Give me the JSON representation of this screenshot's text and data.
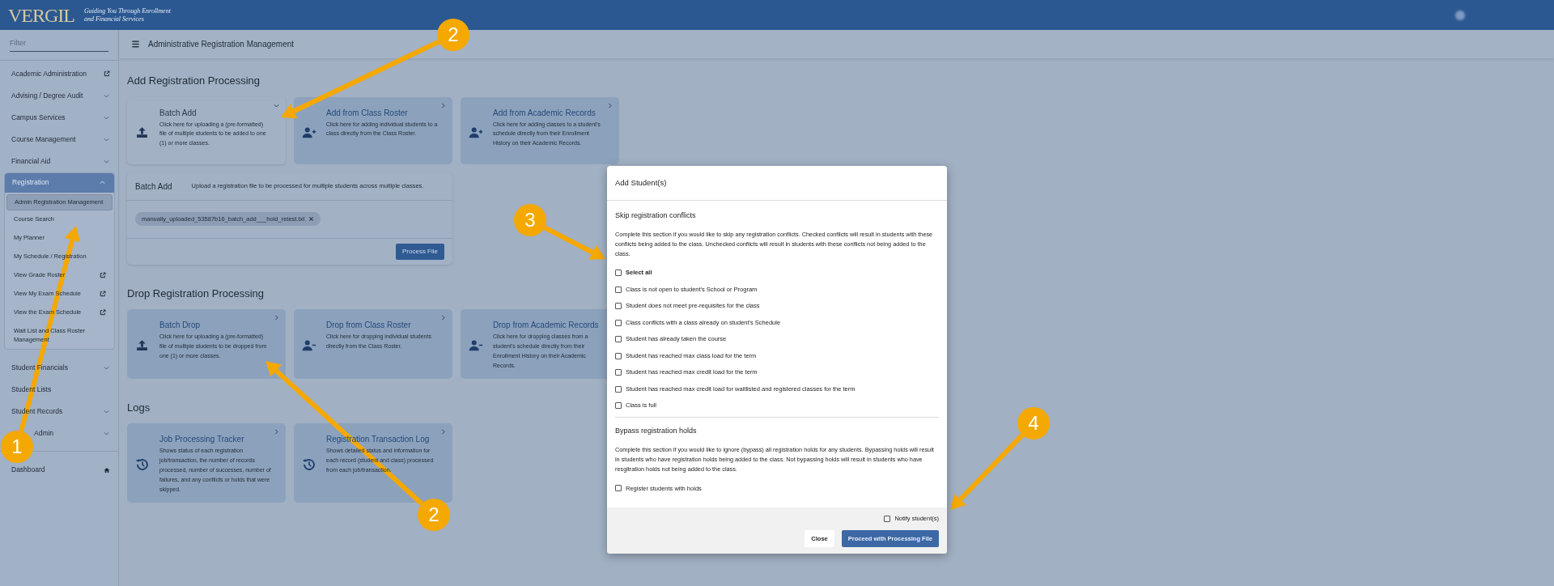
{
  "header": {
    "logo": "VERGIL",
    "tagline": [
      "Guiding You Through Enrollment",
      "and Financial Services"
    ]
  },
  "sidebar": {
    "filter_placeholder": "Filter",
    "items": [
      {
        "label": "Academic Administration",
        "kind": "external"
      },
      {
        "label": "Advising / Degree Audit",
        "kind": "expandable",
        "expanded": false
      },
      {
        "label": "Campus Services",
        "kind": "expandable",
        "expanded": false
      },
      {
        "label": "Course Management",
        "kind": "expandable",
        "expanded": false
      },
      {
        "label": "Financial Aid",
        "kind": "expandable",
        "expanded": false
      },
      {
        "label": "Registration",
        "kind": "expandable",
        "expanded": true,
        "children": [
          {
            "label": "Admin Registration Management",
            "selected": true,
            "external": false
          },
          {
            "label": "Course Search",
            "selected": false,
            "external": false
          },
          {
            "label": "My Planner",
            "selected": false,
            "external": false
          },
          {
            "label": "My Schedule / Registration",
            "selected": false,
            "external": false
          },
          {
            "label": "View Grade Roster",
            "selected": false,
            "external": true
          },
          {
            "label": "View My Exam Schedule",
            "selected": false,
            "external": true
          },
          {
            "label": "View the Exam Schedule",
            "selected": false,
            "external": true
          },
          {
            "label": "Wait List and Class Roster Management",
            "selected": false,
            "external": false
          }
        ]
      },
      {
        "label": "Student Financials",
        "kind": "expandable",
        "expanded": false
      },
      {
        "label": "Student Lists",
        "kind": "plain"
      },
      {
        "label": "Student Records",
        "kind": "expandable",
        "expanded": false
      },
      {
        "label": "Admin",
        "kind": "expandable",
        "expanded": false
      },
      {
        "label": "Dashboard",
        "kind": "home"
      }
    ]
  },
  "page_title": "Administrative Registration Management",
  "sections": [
    {
      "title": "Add Registration Processing",
      "cards": [
        {
          "title": "Batch Add",
          "kind": "upload",
          "expanded": true,
          "description": "Click here for uploading a (pre-formatted) file of multiple students to be added to one (1) or more classes."
        },
        {
          "title": "Add from Class Roster",
          "kind": "person_add",
          "expanded": false,
          "description": "Click here for adding individual students to a class directly from the Class Roster."
        },
        {
          "title": "Add from Academic Records",
          "kind": "person_add",
          "expanded": false,
          "description": "Click here for adding classes to a student's schedule directly from their Enrollment History on their Academic Records."
        }
      ],
      "panel": {
        "title": "Batch Add",
        "description": "Upload a registration file to be processed for multiple students across multiple classes.",
        "file": "manually_uploaded_53587b16_batch_add___hold_retest.txt",
        "button": "Process File"
      }
    },
    {
      "title": "Drop Registration Processing",
      "cards": [
        {
          "title": "Batch Drop",
          "kind": "upload",
          "expanded": false,
          "description": "Click here for uploading a (pre-formatted) file of multiple students to be dropped from one (1) or more classes."
        },
        {
          "title": "Drop from Class Roster",
          "kind": "person_remove",
          "expanded": false,
          "description": "Click here for dropping individual students directly from the Class Roster."
        },
        {
          "title": "Drop from Academic Records",
          "kind": "person_remove",
          "expanded": false,
          "description": "Click here for dropping classes from a student's schedule directly from their Enrollment History on their Academic Records."
        }
      ]
    },
    {
      "title": "Logs",
      "cards": [
        {
          "title": "Job Processing Tracker",
          "kind": "history",
          "expanded": false,
          "description": "Shows status of each registration job/transaction, the number of records processed, number of successes, number of failures, and any conflicts or holds that were skipped."
        },
        {
          "title": "Registration Transaction Log",
          "kind": "history",
          "expanded": false,
          "description": "Shows detailed status and information for each record (student and class) processed from each job/transaction."
        }
      ]
    }
  ],
  "modal": {
    "title": "Add Student(s)",
    "sections": [
      {
        "heading": "Skip registration conflicts",
        "description": "Complete this section if you would like to skip any registration conflicts. Checked conflicts will result in students with these conflicts being added to the class. Unchecked conflicts will result in students with these conflicts not being added to the class.",
        "options": [
          {
            "label": "Select all",
            "kind": "select_all",
            "checked": false
          },
          {
            "label": "Class is not open to student's School or Program",
            "kind": "option",
            "checked": false
          },
          {
            "label": "Student does not meet pre-requisites for the class",
            "kind": "option",
            "checked": false
          },
          {
            "label": "Class conflicts with a class already on student's Schedule",
            "kind": "option",
            "checked": false
          },
          {
            "label": "Student has already taken the course",
            "kind": "option",
            "checked": false
          },
          {
            "label": "Student has reached max class load for the term",
            "kind": "option",
            "checked": false
          },
          {
            "label": "Student has reached max credit load for the term",
            "kind": "option",
            "checked": false
          },
          {
            "label": "Student has reached max credit load for waitlisted and registered classes for the term",
            "kind": "option",
            "checked": false
          },
          {
            "label": "Class is full",
            "kind": "option",
            "checked": false
          }
        ]
      },
      {
        "heading": "Bypass registration holds",
        "description": "Complete this section if you would like to ignore (bypass) all registration holds for any students. Bypassing holds will result in students who have registration holds being added to the class. Not bypassing holds will result in students who have resgitration holds not being added to the class.",
        "options": [
          {
            "label": "Register students with holds",
            "kind": "option",
            "checked": false
          }
        ]
      }
    ],
    "notify": {
      "label": "Notify student(s)",
      "checked": false
    },
    "buttons": [
      {
        "label": "Close",
        "kind": "secondary"
      },
      {
        "label": "Proceed with Processing File",
        "kind": "primary"
      }
    ]
  },
  "annotations": [
    {
      "label": "2"
    },
    {
      "label": "1"
    },
    {
      "label": "3"
    },
    {
      "label": "4"
    },
    {
      "label": "2"
    }
  ]
}
